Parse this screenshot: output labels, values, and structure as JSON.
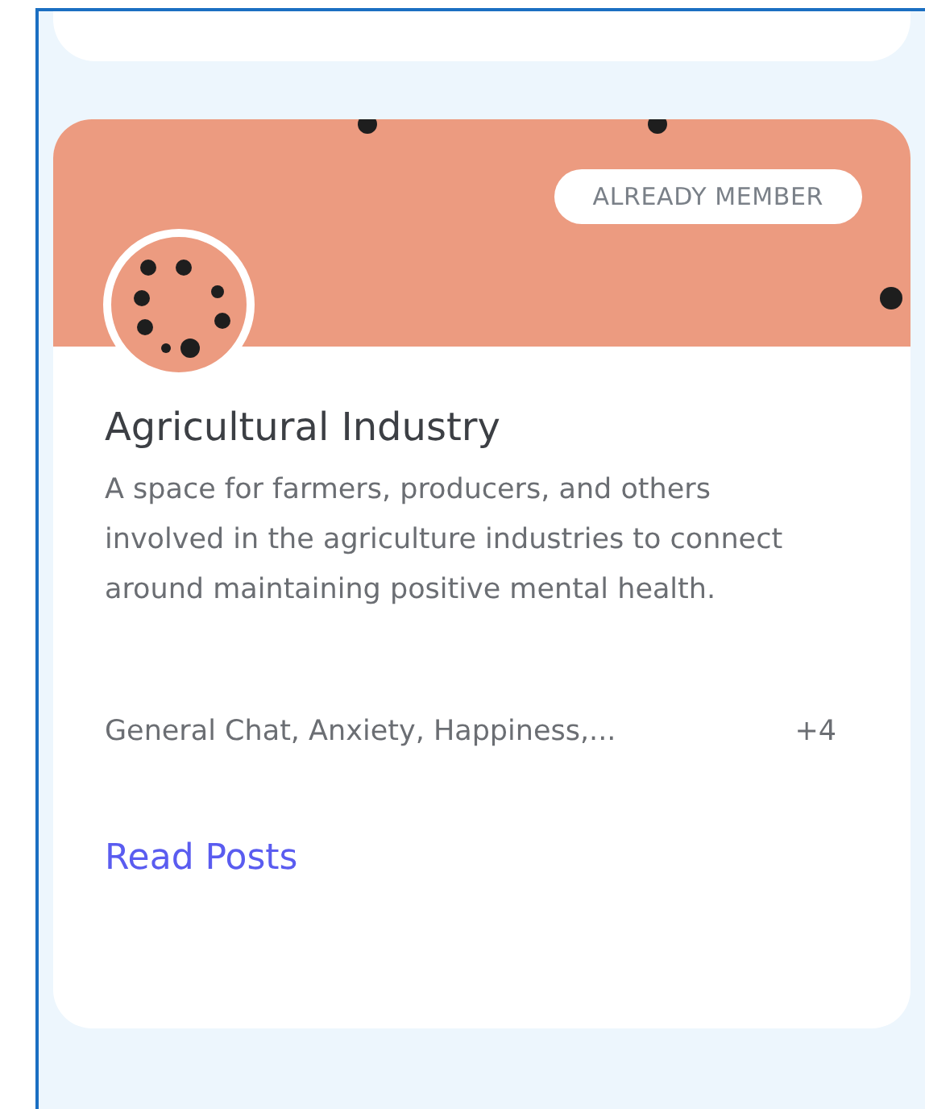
{
  "community_card": {
    "badge": "ALREADY MEMBER",
    "title": "Agricultural Industry",
    "description": "A space for farmers, producers, and others involved in the agriculture industries to connect around maintaining positive mental health.",
    "tags": "General Chat, Anxiety, Happiness,...",
    "tag_count": "+4",
    "link": "Read Posts"
  }
}
